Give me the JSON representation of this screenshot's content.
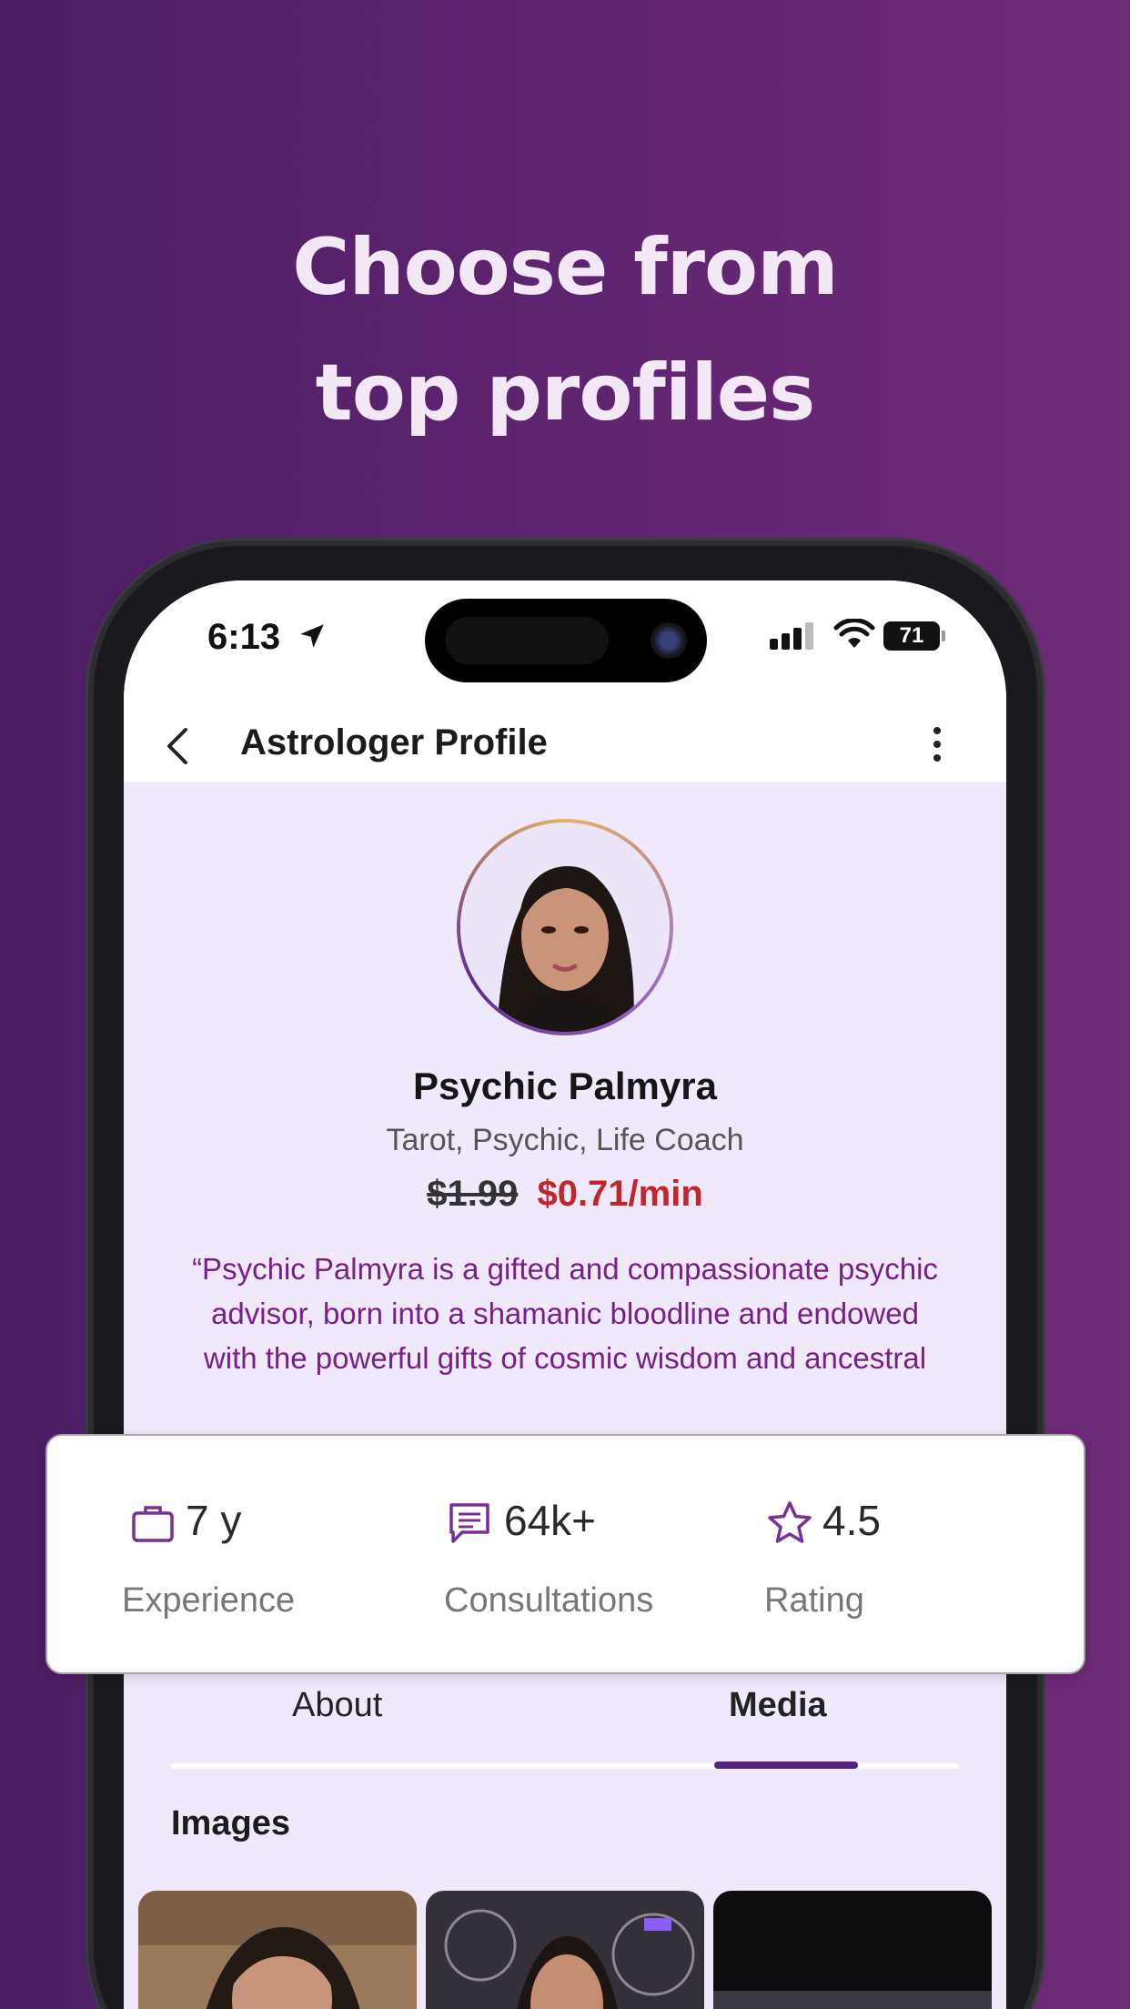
{
  "headline": {
    "line1": "Choose from",
    "line2": "top profiles"
  },
  "status_bar": {
    "time": "6:13",
    "battery": "71"
  },
  "nav": {
    "title": "Astrologer Profile"
  },
  "profile": {
    "name": "Psychic Palmyra",
    "specialties": "Tarot, Psychic, Life Coach",
    "price_old": "$1.99",
    "price_new": "$0.71/min",
    "bio": "“Psychic Palmyra is a gifted and compassionate psychic advisor, born into a shamanic bloodline and endowed with the powerful gifts of cosmic wisdom and ancestral"
  },
  "stats": [
    {
      "icon": "briefcase-icon",
      "value": "7 y",
      "label": "Experience"
    },
    {
      "icon": "chat-message-icon",
      "value": "64k+",
      "label": "Consultations"
    },
    {
      "icon": "star-icon",
      "value": "4.5",
      "label": "Rating"
    }
  ],
  "tabs": {
    "about": "About",
    "media": "Media",
    "active": "Media"
  },
  "media": {
    "section_title": "Images"
  },
  "colors": {
    "background_purple": "#5e2470",
    "accent_purple": "#5a237a",
    "bio_text": "#7a1f88",
    "price_red": "#c0262b",
    "screen_bg": "#efe9fb"
  }
}
